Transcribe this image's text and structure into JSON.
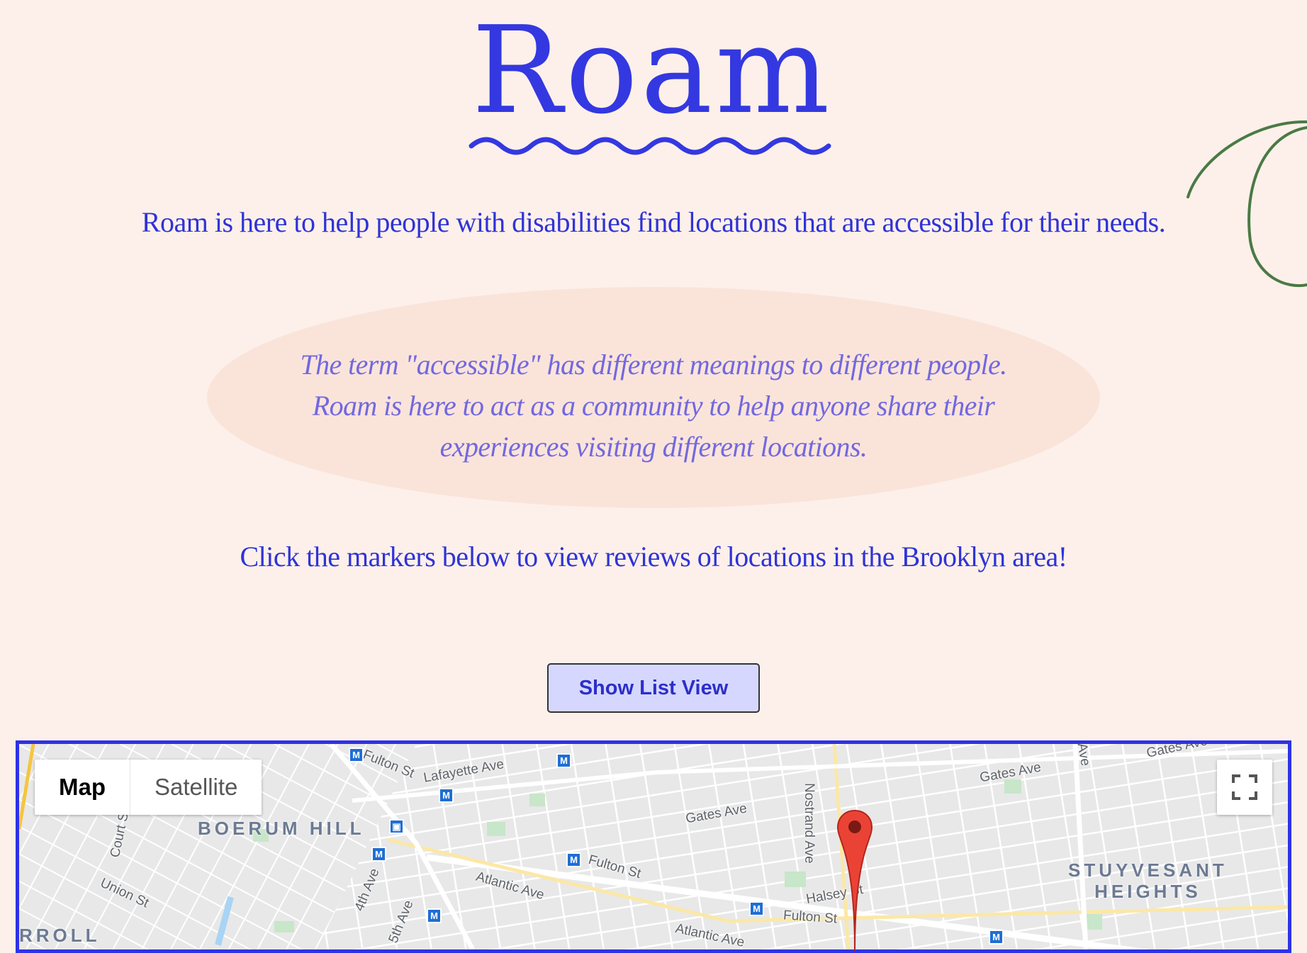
{
  "logo": {
    "text": "Roam"
  },
  "tagline": "Roam is here to help people with disabilities find locations that are accessible for their needs.",
  "quote": {
    "lines": [
      "The term \"accessible\" has different meanings to different people.",
      "Roam is here to act as a community to help anyone share their",
      "experiences visiting different locations."
    ]
  },
  "cta": "Click the markers below to view reviews of locations in the Brooklyn area!",
  "list_button": {
    "label": "Show List View"
  },
  "map": {
    "type_control": {
      "map": "Map",
      "satellite": "Satellite"
    },
    "fullscreen_icon": "fullscreen-icon",
    "neighborhoods": {
      "boerum_hill": "BOERUM HILL",
      "stuyvesant_heights_1": "STUYVESANT",
      "stuyvesant_heights_2": "HEIGHTS",
      "carroll": "RROLL"
    },
    "streets": {
      "fulton_1": "Fulton St",
      "lafayette": "Lafayette Ave",
      "gates_1": "Gates Ave",
      "gates_2": "Gates Ave",
      "gates_3": "Gates Ave",
      "nostrand": "Nostrand Ave",
      "court": "Court St",
      "union": "Union St",
      "fourth_ave": "4th Ave",
      "fifth_ave": "5th Ave",
      "atlantic_1": "Atlantic Ave",
      "atlantic_2": "Atlantic Ave",
      "fulton_2": "Fulton St",
      "fulton_3": "Fulton St",
      "halsey": "Halsey St",
      "ave_top": "Ave"
    },
    "metro_glyph": "M",
    "colors": {
      "border": "#2d32e6",
      "marker": "#ea4335",
      "park": "#c8e6c9",
      "water": "#a8d4f5"
    }
  },
  "colors": {
    "background": "#fdf0ea",
    "accent": "#3438e0",
    "quote": "#7268e0",
    "ellipse": "#fae4da",
    "button": "#d6d7fe"
  }
}
